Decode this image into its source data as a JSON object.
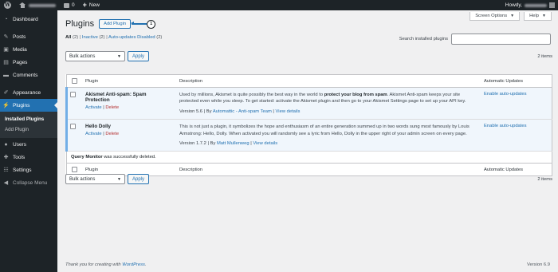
{
  "adminbar": {
    "comments_count": "0",
    "new_label": "New",
    "howdy_label": "Howdy,"
  },
  "sidebar": {
    "items": [
      {
        "label": "Dashboard",
        "icon": "dashboard-icon"
      },
      {
        "label": "Posts",
        "icon": "pin-icon"
      },
      {
        "label": "Media",
        "icon": "media-icon"
      },
      {
        "label": "Pages",
        "icon": "pages-icon"
      },
      {
        "label": "Comments",
        "icon": "comments-icon"
      },
      {
        "label": "Appearance",
        "icon": "brush-icon"
      },
      {
        "label": "Plugins",
        "icon": "plugin-icon"
      },
      {
        "label": "Users",
        "icon": "users-icon"
      },
      {
        "label": "Tools",
        "icon": "wrench-icon"
      },
      {
        "label": "Settings",
        "icon": "settings-icon"
      },
      {
        "label": "Collapse Menu",
        "icon": "collapse-icon"
      }
    ],
    "submenu": [
      "Installed Plugins",
      "Add Plugin"
    ]
  },
  "screen_meta": {
    "screen_options": "Screen Options",
    "help": "Help"
  },
  "page": {
    "title": "Plugins",
    "add_new": "Add Plugin",
    "callout_number": "1"
  },
  "filters": {
    "all": "All",
    "all_count": "(2)",
    "inactive": "Inactive",
    "inactive_count": "(2)",
    "auto_disabled": "Auto-updates Disabled",
    "auto_disabled_count": "(2)"
  },
  "search": {
    "label": "Search installed plugins",
    "value": ""
  },
  "tablenav": {
    "bulk_label": "Bulk actions",
    "apply_label": "Apply",
    "items_count": "2 items"
  },
  "table": {
    "columns": [
      "Plugin",
      "Description",
      "Automatic Updates"
    ],
    "plugins": [
      {
        "name": "Akismet Anti-spam: Spam Protection",
        "activate": "Activate",
        "delete": "Delete",
        "desc_pre": "Used by millions, Akismet is quite possibly the best way in the world to ",
        "desc_bold": "protect your blog from spam",
        "desc_post": ". Akismet Anti-spam keeps your site protected even while you sleep. To get started: activate the Akismet plugin and then go to your Akismet Settings page to set up your API key.",
        "version": "Version 5.6",
        "by": "By",
        "author": "Automattic - Anti-spam Team",
        "details": "View details",
        "auto_updates": "Enable auto-updates"
      },
      {
        "name": "Hello Dolly",
        "activate": "Activate",
        "delete": "Delete",
        "desc_pre": "This is not just a plugin, it symbolizes the hope and enthusiasm of an entire generation summed up in two words sung most famously by Louis Armstrong: Hello, Dolly. When activated you will randomly see a lyric from Hello, Dolly in the upper right of your admin screen on every page.",
        "desc_bold": "",
        "desc_post": "",
        "version": "Version 1.7.2",
        "by": "By",
        "author": "Matt Mullenweg",
        "details": "View details",
        "auto_updates": "Enable auto-updates"
      }
    ],
    "notice_bold": "Query Monitor",
    "notice_text": " was successfully deleted."
  },
  "footer": {
    "thanks_pre": "Thank you for creating with ",
    "thanks_link": "WordPress",
    "thanks_post": ".",
    "version": "Version 6.9"
  },
  "colors": {
    "admin_dark": "#1d2327",
    "accent": "#2271b1",
    "delete": "#b32d2e",
    "page_bg": "#f0f0f1"
  }
}
